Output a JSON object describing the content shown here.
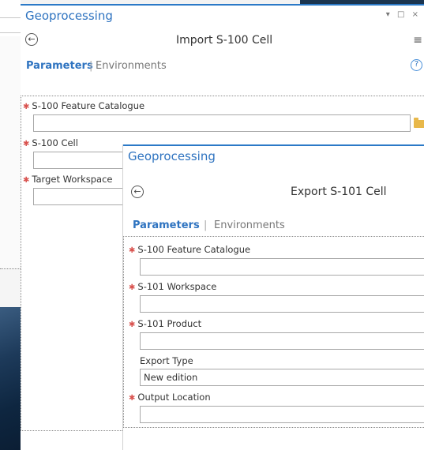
{
  "import_pane": {
    "title": "Geoprocessing",
    "window_controls": "▾ □ ×",
    "tool_name": "Import S-100 Cell",
    "tabs": {
      "parameters": "Parameters",
      "separator": "|",
      "environments": "Environments"
    },
    "params": [
      {
        "label": "S-100 Feature Catalogue",
        "value": "",
        "required": true
      },
      {
        "label": "S-100 Cell",
        "value": "",
        "required": true
      },
      {
        "label": "Target Workspace",
        "value": "",
        "required": true
      }
    ]
  },
  "export_pane": {
    "title": "Geoprocessing",
    "tool_name": "Export S-101 Cell",
    "tabs": {
      "parameters": "Parameters",
      "separator": "|",
      "environments": "Environments"
    },
    "params": [
      {
        "label": "S-100 Feature Catalogue",
        "value": "",
        "required": true
      },
      {
        "label": "S-101 Workspace",
        "value": "",
        "required": true
      },
      {
        "label": "S-101 Product",
        "value": "",
        "required": true
      },
      {
        "label": "Export Type",
        "value": "New edition",
        "required": false
      },
      {
        "label": "Output Location",
        "value": "",
        "required": true
      }
    ]
  },
  "icons": {
    "back": "back-arrow-icon",
    "menu": "hamburger-menu-icon",
    "help": "help-icon",
    "browse": "folder-icon",
    "required": "required-asterisk-icon"
  },
  "colors": {
    "accent": "#2b79c7",
    "title_blue": "#2e73c0",
    "required_red": "#d9534f",
    "folder_yellow": "#e8b84a"
  }
}
